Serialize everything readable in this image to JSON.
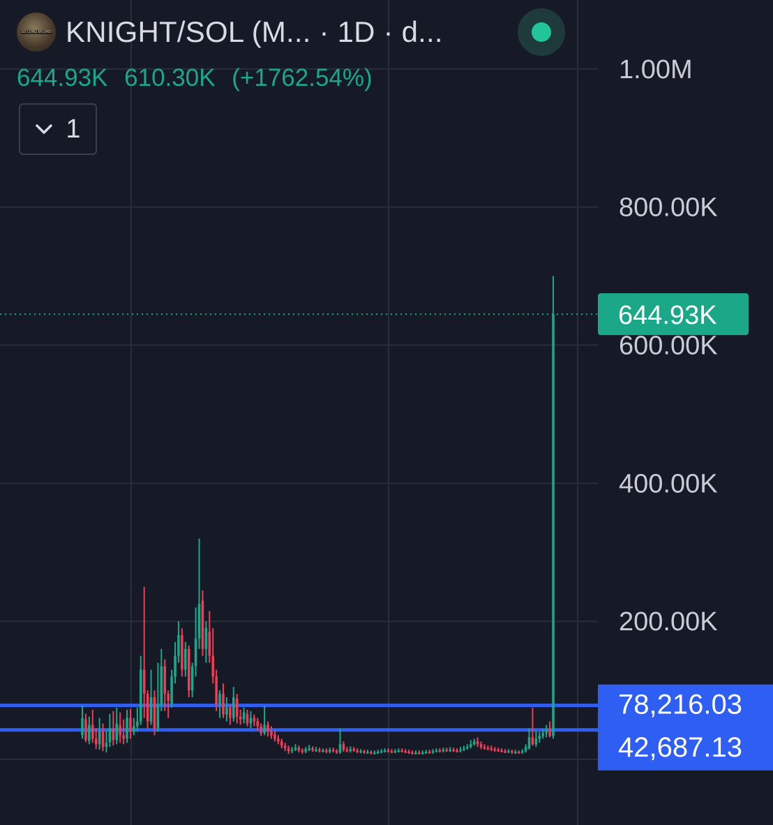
{
  "header": {
    "avatar_text": "SO LONG M'LORD",
    "title": "KNIGHT/SOL (M...  · 1D · d...",
    "status_color": "#22c59a"
  },
  "legend": {
    "last": "644.93K",
    "change": "610.30K",
    "change_pct": "(+1762.54%)"
  },
  "collapse": {
    "icon": "chevron-down-icon",
    "count": "1"
  },
  "colors": {
    "up": "#1aa889",
    "down": "#f03d55",
    "hline": "#2f5ef2",
    "bg": "#161a26",
    "grid": "#2a2e3b",
    "axis_text": "#c9ccd4"
  },
  "chart_data": {
    "type": "candlestick",
    "ylim": [
      -95000,
      1100000
    ],
    "y_ticks": [
      {
        "value": 200000,
        "label": "200.00K"
      },
      {
        "value": 400000,
        "label": "400.00K"
      },
      {
        "value": 600000,
        "label": "600.00K"
      },
      {
        "value": 800000,
        "label": "800.00K"
      },
      {
        "value": 1000000,
        "label": "1.00M"
      }
    ],
    "last_price": {
      "value": 644930,
      "label": "644.93K"
    },
    "horizontal_lines": [
      {
        "value": 78216.03,
        "label": "78,216.03"
      },
      {
        "value": 42687.13,
        "label": "42,687.13"
      }
    ],
    "candles": [
      [
        35000,
        60000,
        30000,
        78000
      ],
      [
        58000,
        28000,
        25000,
        66000
      ],
      [
        27000,
        50000,
        22000,
        62000
      ],
      [
        50000,
        30000,
        24000,
        72000
      ],
      [
        30000,
        22000,
        15000,
        45000
      ],
      [
        22000,
        40000,
        14000,
        60000
      ],
      [
        40000,
        18000,
        12000,
        52000
      ],
      [
        18000,
        24000,
        10000,
        42000
      ],
      [
        25000,
        45000,
        18000,
        66000
      ],
      [
        45000,
        28000,
        20000,
        70000
      ],
      [
        28000,
        52000,
        22000,
        75000
      ],
      [
        50000,
        35000,
        24000,
        68000
      ],
      [
        35000,
        30000,
        22000,
        58000
      ],
      [
        30000,
        60000,
        24000,
        72000
      ],
      [
        60000,
        40000,
        30000,
        73000
      ],
      [
        40000,
        48000,
        35000,
        60000
      ],
      [
        48000,
        55000,
        40000,
        75000
      ],
      [
        55000,
        130000,
        50000,
        150000
      ],
      [
        130000,
        95000,
        60000,
        250000
      ],
      [
        95000,
        55000,
        45000,
        100000
      ],
      [
        55000,
        90000,
        50000,
        130000
      ],
      [
        90000,
        45000,
        35000,
        100000
      ],
      [
        45000,
        80000,
        40000,
        140000
      ],
      [
        80000,
        135000,
        70000,
        160000
      ],
      [
        135000,
        95000,
        70000,
        145000
      ],
      [
        95000,
        85000,
        60000,
        100000
      ],
      [
        80000,
        120000,
        75000,
        130000
      ],
      [
        120000,
        150000,
        110000,
        170000
      ],
      [
        150000,
        180000,
        140000,
        200000
      ],
      [
        180000,
        130000,
        120000,
        190000
      ],
      [
        130000,
        160000,
        120000,
        170000
      ],
      [
        160000,
        100000,
        90000,
        165000
      ],
      [
        100000,
        135000,
        90000,
        140000
      ],
      [
        135000,
        175000,
        120000,
        220000
      ],
      [
        175000,
        225000,
        160000,
        320000
      ],
      [
        230000,
        160000,
        150000,
        245000
      ],
      [
        160000,
        190000,
        140000,
        200000
      ],
      [
        185000,
        150000,
        140000,
        215000
      ],
      [
        150000,
        120000,
        110000,
        190000
      ],
      [
        120000,
        80000,
        70000,
        130000
      ],
      [
        80000,
        95000,
        60000,
        100000
      ],
      [
        95000,
        65000,
        60000,
        110000
      ],
      [
        65000,
        75000,
        55000,
        90000
      ],
      [
        75000,
        60000,
        50000,
        80000
      ],
      [
        60000,
        90000,
        55000,
        105000
      ],
      [
        88000,
        62000,
        52000,
        95000
      ],
      [
        62000,
        58000,
        50000,
        72000
      ],
      [
        58000,
        68000,
        52000,
        75000
      ],
      [
        66000,
        52000,
        48000,
        72000
      ],
      [
        52000,
        60000,
        45000,
        70000
      ],
      [
        60000,
        55000,
        48000,
        65000
      ],
      [
        55000,
        48000,
        42000,
        60000
      ],
      [
        48000,
        38000,
        34000,
        52000
      ],
      [
        38000,
        50000,
        35000,
        78000
      ],
      [
        50000,
        40000,
        33000,
        55000
      ],
      [
        40000,
        35000,
        30000,
        48000
      ],
      [
        36000,
        30000,
        26000,
        42000
      ],
      [
        30000,
        26000,
        22000,
        35000
      ],
      [
        26000,
        20000,
        16000,
        30000
      ],
      [
        20000,
        16000,
        12000,
        24000
      ],
      [
        16000,
        12000,
        8000,
        20000
      ],
      [
        12000,
        14000,
        9000,
        18000
      ],
      [
        14000,
        17000,
        12000,
        22000
      ],
      [
        17000,
        13000,
        10000,
        20000
      ],
      [
        13000,
        11000,
        8000,
        16000
      ],
      [
        11000,
        15000,
        9000,
        18000
      ],
      [
        15000,
        16000,
        12000,
        21000
      ],
      [
        16000,
        13000,
        11000,
        19000
      ],
      [
        13000,
        14000,
        11000,
        18000
      ],
      [
        14000,
        12000,
        10000,
        17000
      ],
      [
        12000,
        13000,
        10000,
        16000
      ],
      [
        13000,
        11000,
        9000,
        16000
      ],
      [
        11000,
        14000,
        9000,
        17000
      ],
      [
        14000,
        12000,
        10000,
        17000
      ],
      [
        12000,
        10000,
        8000,
        15000
      ],
      [
        10000,
        22000,
        8000,
        45000
      ],
      [
        22000,
        14000,
        11000,
        26000
      ],
      [
        14000,
        12000,
        10000,
        18000
      ],
      [
        12000,
        15000,
        10000,
        19000
      ],
      [
        15000,
        13000,
        11000,
        18000
      ],
      [
        13000,
        11000,
        9000,
        16000
      ],
      [
        11000,
        12000,
        9000,
        15000
      ],
      [
        12000,
        10000,
        8000,
        14000
      ],
      [
        10000,
        11000,
        8000,
        14000
      ],
      [
        11000,
        9000,
        7000,
        13000
      ],
      [
        9000,
        10000,
        7000,
        13000
      ],
      [
        10000,
        11000,
        8000,
        14000
      ],
      [
        11000,
        12000,
        9000,
        15000
      ],
      [
        12000,
        13000,
        10000,
        16000
      ],
      [
        13000,
        12000,
        10000,
        16000
      ],
      [
        12000,
        11000,
        9000,
        15000
      ],
      [
        11000,
        12000,
        9000,
        15000
      ],
      [
        12000,
        13000,
        10000,
        16000
      ],
      [
        13000,
        12000,
        10000,
        16000
      ],
      [
        12000,
        11000,
        9000,
        15000
      ],
      [
        11000,
        10000,
        8000,
        14000
      ],
      [
        10000,
        9000,
        7000,
        13000
      ],
      [
        9000,
        10000,
        7000,
        13000
      ],
      [
        10000,
        9000,
        7000,
        13000
      ],
      [
        9000,
        10000,
        7000,
        13000
      ],
      [
        10000,
        11000,
        8000,
        14000
      ],
      [
        11000,
        10000,
        8000,
        14000
      ],
      [
        10000,
        12000,
        8000,
        15000
      ],
      [
        12000,
        13000,
        10000,
        16000
      ],
      [
        13000,
        12000,
        10000,
        16000
      ],
      [
        12000,
        14000,
        10000,
        17000
      ],
      [
        14000,
        13000,
        11000,
        17000
      ],
      [
        13000,
        14000,
        11000,
        18000
      ],
      [
        14000,
        13000,
        11000,
        17000
      ],
      [
        13000,
        12000,
        10000,
        16000
      ],
      [
        12000,
        14000,
        10000,
        18000
      ],
      [
        14000,
        16000,
        12000,
        20000
      ],
      [
        16000,
        18000,
        14000,
        22000
      ],
      [
        18000,
        22000,
        16000,
        28000
      ],
      [
        22000,
        26000,
        20000,
        30000
      ],
      [
        26000,
        22000,
        18000,
        32000
      ],
      [
        22000,
        18000,
        15000,
        26000
      ],
      [
        18000,
        17000,
        14000,
        22000
      ],
      [
        17000,
        16000,
        13000,
        20000
      ],
      [
        16000,
        15000,
        12000,
        20000
      ],
      [
        15000,
        14000,
        11000,
        18000
      ],
      [
        14000,
        13000,
        11000,
        17000
      ],
      [
        13000,
        12000,
        10000,
        16000
      ],
      [
        12000,
        11000,
        9000,
        15000
      ],
      [
        11000,
        12000,
        9000,
        15000
      ],
      [
        12000,
        10000,
        8000,
        14000
      ],
      [
        10000,
        11000,
        8000,
        14000
      ],
      [
        11000,
        10000,
        8000,
        13000
      ],
      [
        10000,
        12000,
        8000,
        15000
      ],
      [
        12000,
        18000,
        10000,
        22000
      ],
      [
        16000,
        32000,
        14000,
        45000
      ],
      [
        32000,
        22000,
        20000,
        75000
      ],
      [
        22000,
        30000,
        18000,
        42000
      ],
      [
        30000,
        34000,
        24000,
        40000
      ],
      [
        34000,
        38000,
        30000,
        44000
      ],
      [
        38000,
        44000,
        32000,
        50000
      ],
      [
        44000,
        34000,
        32000,
        55000
      ],
      [
        34000,
        644930,
        30000,
        700000
      ]
    ]
  }
}
